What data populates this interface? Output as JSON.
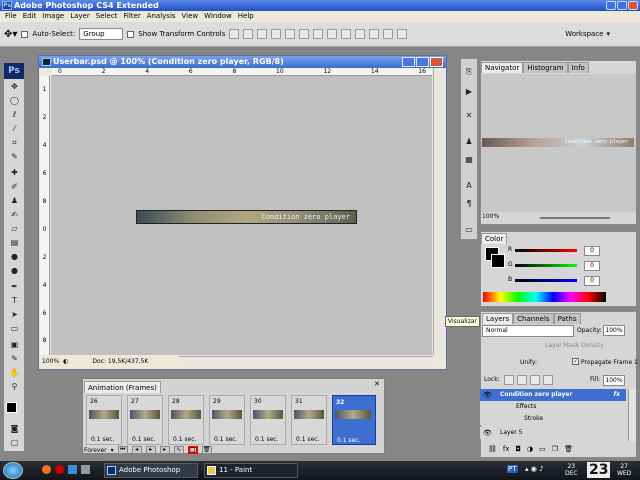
{
  "window": {
    "title": "Adobe Photoshop CS4 Extended",
    "app_icon": "Ps"
  },
  "menubar": [
    "File",
    "Edit",
    "Image",
    "Layer",
    "Select",
    "Filter",
    "Analysis",
    "View",
    "Window",
    "Help"
  ],
  "options": {
    "auto_select_label": "Auto-Select:",
    "auto_select_value": "Group",
    "show_transform_label": "Show Transform Controls",
    "workspace_label": "Workspace"
  },
  "toolbox": {
    "logo": "Ps",
    "tools": [
      "move-tool-icon",
      "marquee-tool-icon",
      "lasso-tool-icon",
      "magic-wand-icon",
      "crop-tool-icon",
      "eyedropper-icon",
      "healing-brush-icon",
      "brush-tool-icon",
      "clone-stamp-icon",
      "history-brush-icon",
      "eraser-icon",
      "gradient-tool-icon",
      "blur-tool-icon",
      "dodge-tool-icon",
      "pen-tool-icon",
      "type-tool-icon",
      "path-select-icon",
      "shape-tool-icon",
      "notes-tool-icon",
      "eyedropper-3d-icon",
      "hand-tool-icon",
      "zoom-tool-icon"
    ]
  },
  "document": {
    "title": "Userbar.psd @ 100% (Condition zero player, RGB/8)",
    "ruler_h": [
      "0",
      "2",
      "4",
      "6",
      "8",
      "10",
      "12",
      "14",
      "16"
    ],
    "ruler_v": [
      "1",
      "2",
      "4",
      "6",
      "8",
      "0",
      "2",
      "4",
      "6",
      "8"
    ],
    "zoom": "100%",
    "doc_size": "Doc: 19,5K/437,5K",
    "userbar_text": "Condition zero player"
  },
  "animation": {
    "tab": "Animation (Frames)",
    "frames": [
      {
        "num": "26",
        "delay": "0.1 sec."
      },
      {
        "num": "27",
        "delay": "0.1 sec."
      },
      {
        "num": "28",
        "delay": "0.1 sec."
      },
      {
        "num": "29",
        "delay": "0.1 sec."
      },
      {
        "num": "30",
        "delay": "0.1 sec."
      },
      {
        "num": "31",
        "delay": "0.1 sec."
      },
      {
        "num": "32",
        "delay": "0.1 sec."
      }
    ],
    "selected_frame": 6,
    "loop": "Forever"
  },
  "navigator": {
    "tabs": [
      "Navigator",
      "Histogram",
      "Info"
    ],
    "zoom": "100%",
    "thumb_text": "Condition zero player"
  },
  "color": {
    "tabs": [
      "Color"
    ],
    "channels": [
      {
        "label": "R",
        "value": "0"
      },
      {
        "label": "G",
        "value": "0"
      },
      {
        "label": "B",
        "value": "0"
      }
    ]
  },
  "tooltip": "Visualizar",
  "layers": {
    "tabs": [
      "Layers",
      "Channels",
      "Paths"
    ],
    "blend_mode": "Normal",
    "opacity_label": "Opacity:",
    "opacity": "100%",
    "mask_density": "Layer Mask Density",
    "unify_label": "Unify:",
    "propagate_label": "Propagate Frame 1",
    "lock_label": "Lock:",
    "fill_label": "Fill:",
    "fill": "100%",
    "rows": [
      {
        "name": "Condition zero player",
        "fx": "fx"
      },
      {
        "name": "Effects"
      },
      {
        "name": "Stroke"
      },
      {
        "name": "Layer 5"
      }
    ]
  },
  "taskbar": {
    "tasks": [
      "Adobe Photoshop CS...",
      "11 - Paint"
    ],
    "lang": "PT",
    "date_month": "DEC",
    "date_day": "23",
    "date_big": "23",
    "date_day2": "27",
    "weekday": "WED"
  }
}
